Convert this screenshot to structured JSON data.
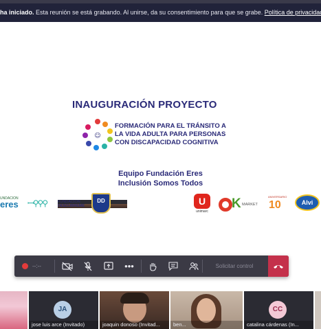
{
  "banner": {
    "bold_text": "ha iniciado.",
    "text": " Esta reunión se está grabando. Al unirse, da su consentimiento para que se grabe. ",
    "link": "Política de privacidad"
  },
  "slide": {
    "title": "INAUGURACIÓN PROYECTO",
    "subtitle_lines": [
      "FORMACIÓN PARA EL TRÁNSITO A",
      "LA VIDA ADULTA PARA PERSONAS",
      "CON DISCAPACIDAD COGNITIVA"
    ],
    "team_line1": "Equipo Fundación Eres",
    "team_line2": "Inclusión Somos Todos",
    "logos": {
      "eres_small": "UNDACION",
      "eres_big": "eres",
      "descubreme_1": "FUNDACION",
      "descubreme_2": "DESCUBREME",
      "shield": "DD",
      "unimarc_mark": "U",
      "unimarc_text": "unimarc",
      "ok_market": "MARKET",
      "ten_top": "ANIVERSARIO",
      "ten_num": "10",
      "alvi": "Alvi"
    }
  },
  "toolbar": {
    "timer": "--:--",
    "request_control": "Solicitar control",
    "icons": [
      "record-icon",
      "camera-off-icon",
      "mic-off-icon",
      "share-icon",
      "more-icon",
      "raise-hand-icon",
      "chat-icon",
      "participants-icon",
      "hang-up-icon"
    ]
  },
  "participants": [
    {
      "name": "",
      "initials": ""
    },
    {
      "name": "jose luis arce (Invitado)",
      "initials": "JA"
    },
    {
      "name": "joaquin donoso (Invitad...",
      "initials": ""
    },
    {
      "name": "ben...",
      "initials": ""
    },
    {
      "name": "catalina cárdenas (In...",
      "initials": "CC"
    }
  ],
  "colors": {
    "banner_bg": "#21233a",
    "slide_text": "#2a2a78",
    "toolbar_bg": "#3b3a45",
    "hangup": "#c4314b"
  }
}
